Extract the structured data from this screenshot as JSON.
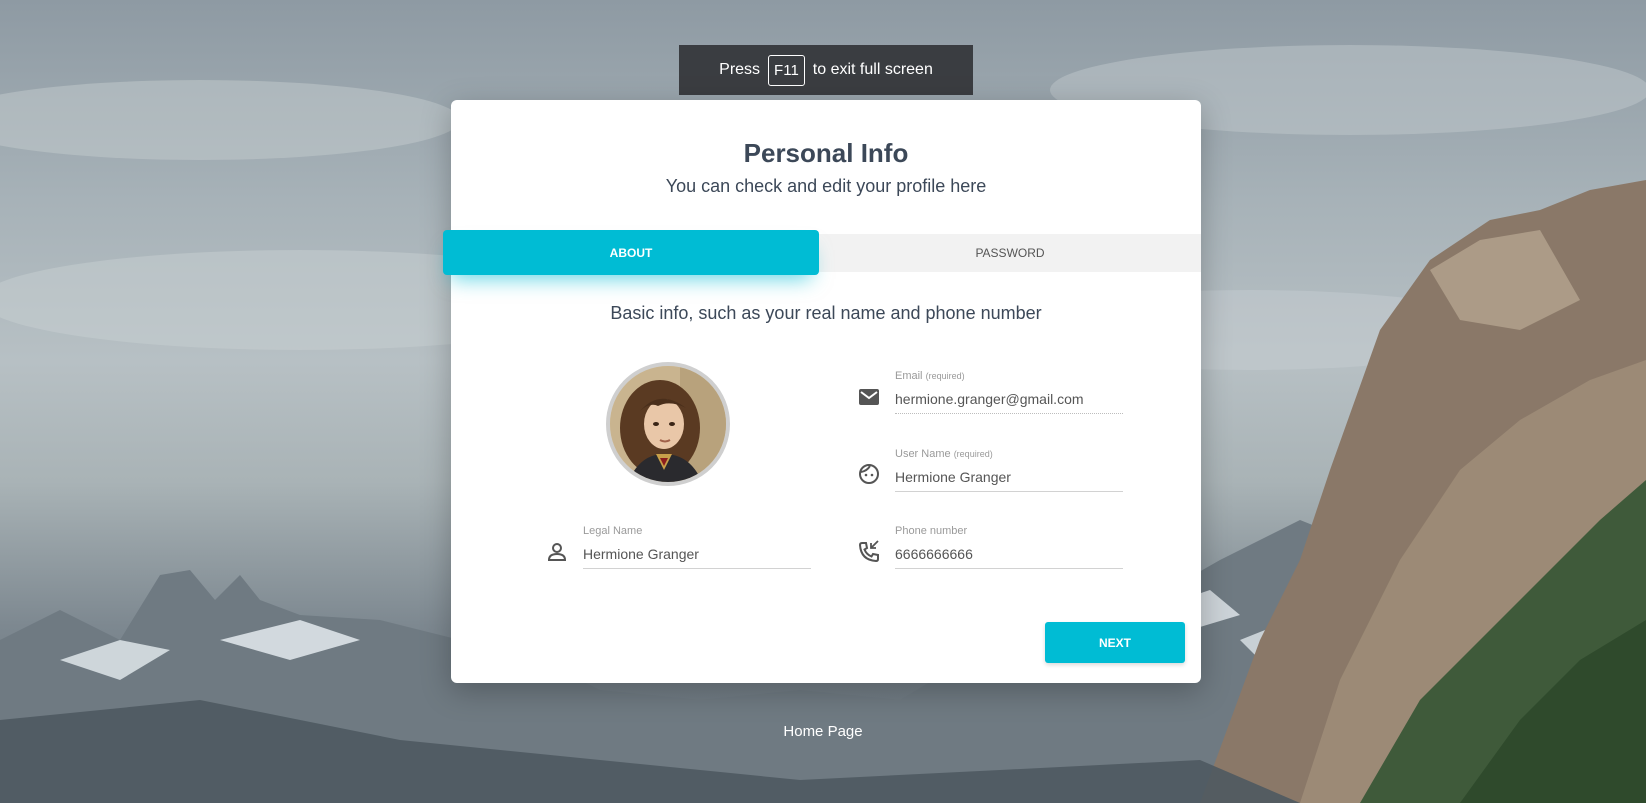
{
  "fullscreen_notice": {
    "prefix": "Press",
    "key": "F11",
    "suffix": "to exit full screen"
  },
  "card": {
    "title": "Personal Info",
    "subtitle": "You can check and edit your profile here",
    "tabs": [
      {
        "label": "ABOUT",
        "active": true
      },
      {
        "label": "PASSWORD",
        "active": false
      }
    ],
    "section_description": "Basic info, such as your real name and phone number",
    "fields": {
      "legal_name": {
        "label": "Legal Name",
        "value": "Hermione Granger",
        "icon": "person-icon"
      },
      "email": {
        "label": "Email",
        "required_note": "(required)",
        "value": "hermione.granger@gmail.com",
        "icon": "mail-icon"
      },
      "username": {
        "label": "User Name",
        "required_note": "(required)",
        "value": "Hermione Granger",
        "icon": "face-icon"
      },
      "phone": {
        "label": "Phone number",
        "value": "6666666666",
        "icon": "phone-icon"
      }
    },
    "next_label": "NEXT"
  },
  "footer": {
    "home_link": "Home Page"
  },
  "colors": {
    "accent": "#00bcd4",
    "title": "#3c4858",
    "tab_bar": "#f2f2f2"
  }
}
